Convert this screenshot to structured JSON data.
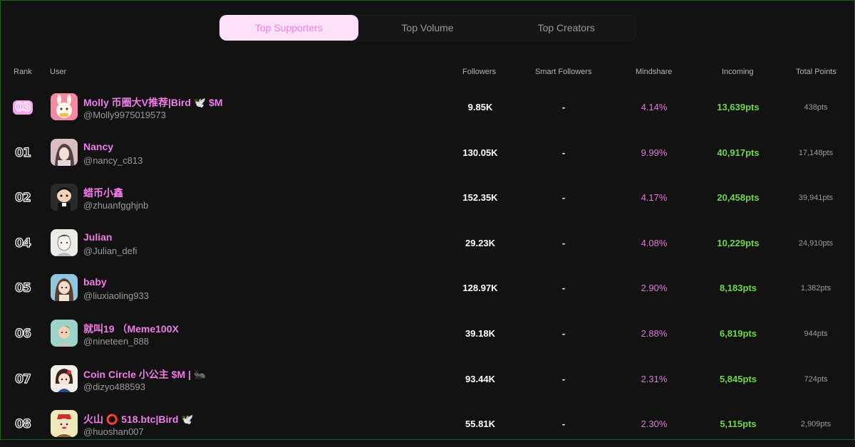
{
  "tabs": [
    {
      "label": "Top Supporters",
      "active": true
    },
    {
      "label": "Top Volume",
      "active": false
    },
    {
      "label": "Top Creators",
      "active": false
    }
  ],
  "columns": {
    "rank": "Rank",
    "user": "User",
    "followers": "Followers",
    "smart_followers": "Smart Followers",
    "mindshare": "Mindshare",
    "incoming": "Incoming",
    "total_points": "Total Points"
  },
  "rows": [
    {
      "rank": "03",
      "highlight": true,
      "name": "Molly 币圈大V推荐|Bird 🕊️ $M",
      "handle": "@Molly9975019573",
      "followers": "9.85K",
      "smart_followers": "-",
      "mindshare": "4.14%",
      "incoming": "13,639pts",
      "total_points": "438pts",
      "avatar": "cartoon-character"
    },
    {
      "rank": "01",
      "highlight": false,
      "name": "Nancy",
      "handle": "@nancy_c813",
      "followers": "130.05K",
      "smart_followers": "-",
      "mindshare": "9.99%",
      "incoming": "40,917pts",
      "total_points": "17,148pts",
      "avatar": "photo-person"
    },
    {
      "rank": "02",
      "highlight": false,
      "name": "蜡币小鑫",
      "handle": "@zhuanfgghjnb",
      "followers": "152.35K",
      "smart_followers": "-",
      "mindshare": "4.17%",
      "incoming": "20,458pts",
      "total_points": "39,941pts",
      "avatar": "cartoon-boy"
    },
    {
      "rank": "04",
      "highlight": false,
      "name": "Julian",
      "handle": "@Julian_defi",
      "followers": "29.23K",
      "smart_followers": "-",
      "mindshare": "4.08%",
      "incoming": "10,229pts",
      "total_points": "24,910pts",
      "avatar": "sketch-face"
    },
    {
      "rank": "05",
      "highlight": false,
      "name": "baby",
      "handle": "@liuxiaoling933",
      "followers": "128.97K",
      "smart_followers": "-",
      "mindshare": "2.90%",
      "incoming": "8,183pts",
      "total_points": "1,382pts",
      "avatar": "anime-girl"
    },
    {
      "rank": "06",
      "highlight": false,
      "name": "就叫19 （Meme100X",
      "handle": "@nineteen_888",
      "followers": "39.18K",
      "smart_followers": "-",
      "mindshare": "2.88%",
      "incoming": "6,819pts",
      "total_points": "944pts",
      "avatar": "cartoon-man"
    },
    {
      "rank": "07",
      "highlight": false,
      "name": "Coin Circle 小公主 $M | 🐜",
      "handle": "@dizyo488593",
      "followers": "93.44K",
      "smart_followers": "-",
      "mindshare": "2.31%",
      "incoming": "5,845pts",
      "total_points": "724pts",
      "avatar": "cartoon-girl"
    },
    {
      "rank": "08",
      "highlight": false,
      "name": "火山 ⭕ 518.btc|Bird 🕊️",
      "handle": "@huoshan007",
      "followers": "55.81K",
      "smart_followers": "-",
      "mindshare": "2.30%",
      "incoming": "5,115pts",
      "total_points": "2,909pts",
      "avatar": "cartoon-dog"
    }
  ]
}
